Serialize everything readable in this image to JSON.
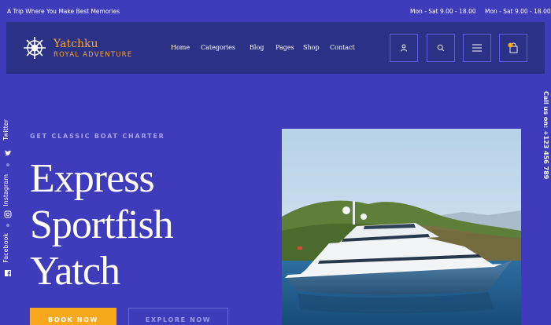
{
  "topbar": {
    "tagline": "A Trip Where You Make Best Memories",
    "hours": [
      "Mon - Sat 9.00 - 18.00",
      "Mon - Sat 9.00 - 18.00"
    ]
  },
  "brand": {
    "name": "Yatchku",
    "subtitle": "ROYAL ADVENTURE",
    "accent_color": "#f3a536",
    "logo_icon": "ship-wheel-icon"
  },
  "nav": {
    "items": [
      "Home",
      "Categories",
      "Blog",
      "Pages",
      "Shop",
      "Contact"
    ]
  },
  "actions": [
    {
      "icon": "user-icon"
    },
    {
      "icon": "search-icon"
    },
    {
      "icon": "hamburger-menu-icon"
    },
    {
      "icon": "cart-icon",
      "badge_color": "#f7a81b"
    }
  ],
  "social": [
    "Twitter",
    "Instagram",
    "Facebook"
  ],
  "call": {
    "text": "Call us on:  +123 456 789"
  },
  "hero": {
    "eyebrow": "GET CLASSIC BOAT CHARTER",
    "title_lines": [
      "Express",
      "Sportfish",
      "Yatch"
    ],
    "primary_button": "BOOK NOW",
    "secondary_button": "EXPLORE NOW"
  },
  "colors": {
    "background": "#3f3cbb",
    "navbar": "#2b3286",
    "button_primary": "#f7a81b"
  }
}
